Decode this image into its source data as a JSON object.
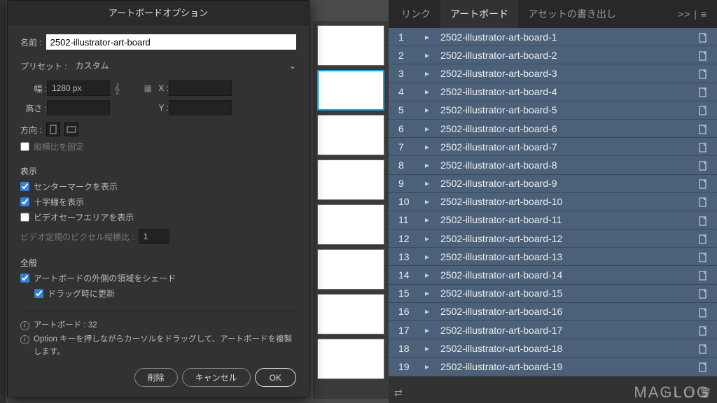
{
  "dialog": {
    "title": "アートボードオプション",
    "name_label": "名前 :",
    "name_value": "2502-illustrator-art-board",
    "preset_label": "プリセット :",
    "preset_value": "カスタム",
    "width_label": "幅 :",
    "width_value": "1280 px",
    "height_label": "高さ :",
    "x_label": "X :",
    "y_label": "Y :",
    "orient_label": "方向 :",
    "lock_aspect": "縦横比を固定",
    "display_section": "表示",
    "show_center": "センターマークを表示",
    "show_cross": "十字線を表示",
    "show_safe": "ビデオセーフエリアを表示",
    "pixel_ratio_label": "ビデオ定規のピクセル縦横比 :",
    "pixel_ratio_value": "1",
    "general_section": "全般",
    "shade_outside": "アートボードの外側の領域をシェード",
    "update_on_drag": "ドラッグ時に更新",
    "info1": "アートボード : 32",
    "info2": "Option キーを押しながらカーソルをドラッグして、アートボードを複製します。",
    "btn_delete": "削除",
    "btn_cancel": "キャンセル",
    "btn_ok": "OK"
  },
  "panel": {
    "tab_link": "リンク",
    "tab_artboard": "アートボード",
    "tab_export": "アセットの書き出し",
    "more": ">>",
    "rows": [
      {
        "n": "1",
        "name": "2502-illustrator-art-board-1"
      },
      {
        "n": "2",
        "name": "2502-illustrator-art-board-2"
      },
      {
        "n": "3",
        "name": "2502-illustrator-art-board-3"
      },
      {
        "n": "4",
        "name": "2502-illustrator-art-board-4"
      },
      {
        "n": "5",
        "name": "2502-illustrator-art-board-5"
      },
      {
        "n": "6",
        "name": "2502-illustrator-art-board-6"
      },
      {
        "n": "7",
        "name": "2502-illustrator-art-board-7"
      },
      {
        "n": "8",
        "name": "2502-illustrator-art-board-8"
      },
      {
        "n": "9",
        "name": "2502-illustrator-art-board-9"
      },
      {
        "n": "10",
        "name": "2502-illustrator-art-board-10"
      },
      {
        "n": "11",
        "name": "2502-illustrator-art-board-11"
      },
      {
        "n": "12",
        "name": "2502-illustrator-art-board-12"
      },
      {
        "n": "13",
        "name": "2502-illustrator-art-board-13"
      },
      {
        "n": "14",
        "name": "2502-illustrator-art-board-14"
      },
      {
        "n": "15",
        "name": "2502-illustrator-art-board-15"
      },
      {
        "n": "16",
        "name": "2502-illustrator-art-board-16"
      },
      {
        "n": "17",
        "name": "2502-illustrator-art-board-17"
      },
      {
        "n": "18",
        "name": "2502-illustrator-art-board-18"
      },
      {
        "n": "19",
        "name": "2502-illustrator-art-board-19"
      }
    ]
  },
  "watermark": "MAGLOG"
}
